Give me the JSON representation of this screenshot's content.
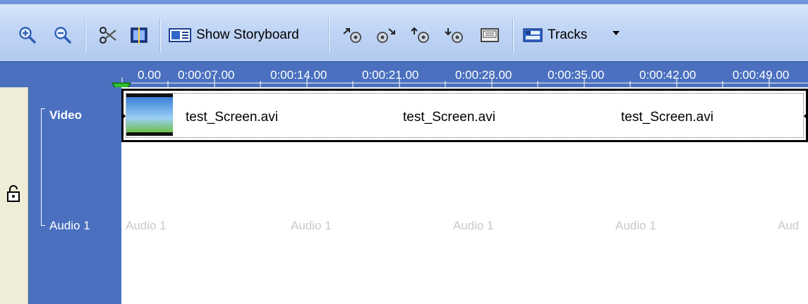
{
  "toolbar": {
    "buttons": [
      {
        "name": "zoom-in-icon"
      },
      {
        "name": "zoom-out-icon"
      },
      {
        "name": "split-clip-icon"
      },
      {
        "name": "split-screen-icon"
      },
      {
        "name": "show-storyboard-icon",
        "label": "Show Storyboard"
      },
      {
        "name": "fade-in-icon"
      },
      {
        "name": "fade-out-icon"
      },
      {
        "name": "volume-up-icon"
      },
      {
        "name": "volume-down-icon"
      },
      {
        "name": "mute-icon"
      },
      {
        "name": "tracks-icon",
        "label": "Tracks"
      }
    ]
  },
  "ruler": {
    "labels": [
      "0.00",
      "0:00:07.00",
      "0:00:14.00",
      "0:00:21.00",
      "0:00:28.00",
      "0:00:35.00",
      "0:00:42.00",
      "0:00:49.00"
    ]
  },
  "tracks": {
    "video": {
      "title": "Video",
      "clips": [
        "test_Screen.avi",
        "test_Screen.avi",
        "test_Screen.avi"
      ]
    },
    "audio": {
      "title": "Audio 1",
      "placeholders": [
        "Audio 1",
        "Audio 1",
        "Audio 1",
        "Audio 1",
        "Aud"
      ]
    }
  },
  "colors": {
    "ruler_bg": "#4a70bf",
    "toolbar_bg": "#c2d6f6",
    "lock_bar_bg": "#efecd8",
    "playhead": "#2fbf2f"
  }
}
